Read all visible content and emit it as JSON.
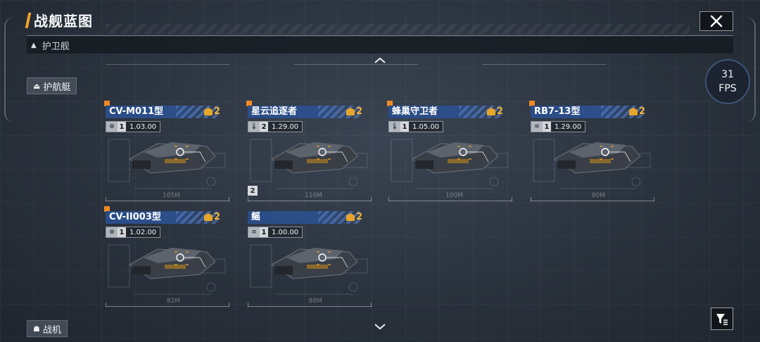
{
  "header": {
    "title": "战舰蓝图",
    "close_icon": "close-icon"
  },
  "category": {
    "label": "护卫舰",
    "arrow_icon": "triangle-up-icon"
  },
  "side_tabs": {
    "escort": {
      "label": "护航艇",
      "icon": "escort-ship-icon"
    },
    "fighter": {
      "label": "战机",
      "icon": "fighter-icon"
    }
  },
  "fps": {
    "value": "31",
    "unit": "FPS"
  },
  "colors": {
    "accent": "#f0a42a",
    "name_bar": "#2c4f8a",
    "tier_gold": "#f0b43a",
    "corner_marker": "#f08a24"
  },
  "ships": [
    {
      "name": "CV-M011型",
      "tier": "2",
      "level": "1",
      "value": "1.03.00",
      "stat_icon": "globe-icon",
      "length": "105M",
      "tier_mark": ""
    },
    {
      "name": "星云追逐者",
      "tier": "2",
      "level": "2",
      "value": "1.29.00",
      "stat_icon": "thermometer-icon",
      "length": "110M",
      "tier_mark": "2"
    },
    {
      "name": "蜂巢守卫者",
      "tier": "2",
      "level": "1",
      "value": "1.05.00",
      "stat_icon": "thermometer-icon",
      "length": "100M",
      "tier_mark": ""
    },
    {
      "name": "RB7-13型",
      "tier": "2",
      "level": "1",
      "value": "1.29.00",
      "stat_icon": "speed-icon",
      "length": "80M",
      "tier_mark": ""
    },
    {
      "name": "CV-II003型",
      "tier": "2",
      "level": "1",
      "value": "1.02.00",
      "stat_icon": "globe-icon",
      "length": "82M",
      "tier_mark": ""
    },
    {
      "name": "鳐",
      "tier": "2",
      "level": "1",
      "value": "1.00.00",
      "stat_icon": "speed-icon",
      "length": "88M",
      "tier_mark": ""
    }
  ]
}
